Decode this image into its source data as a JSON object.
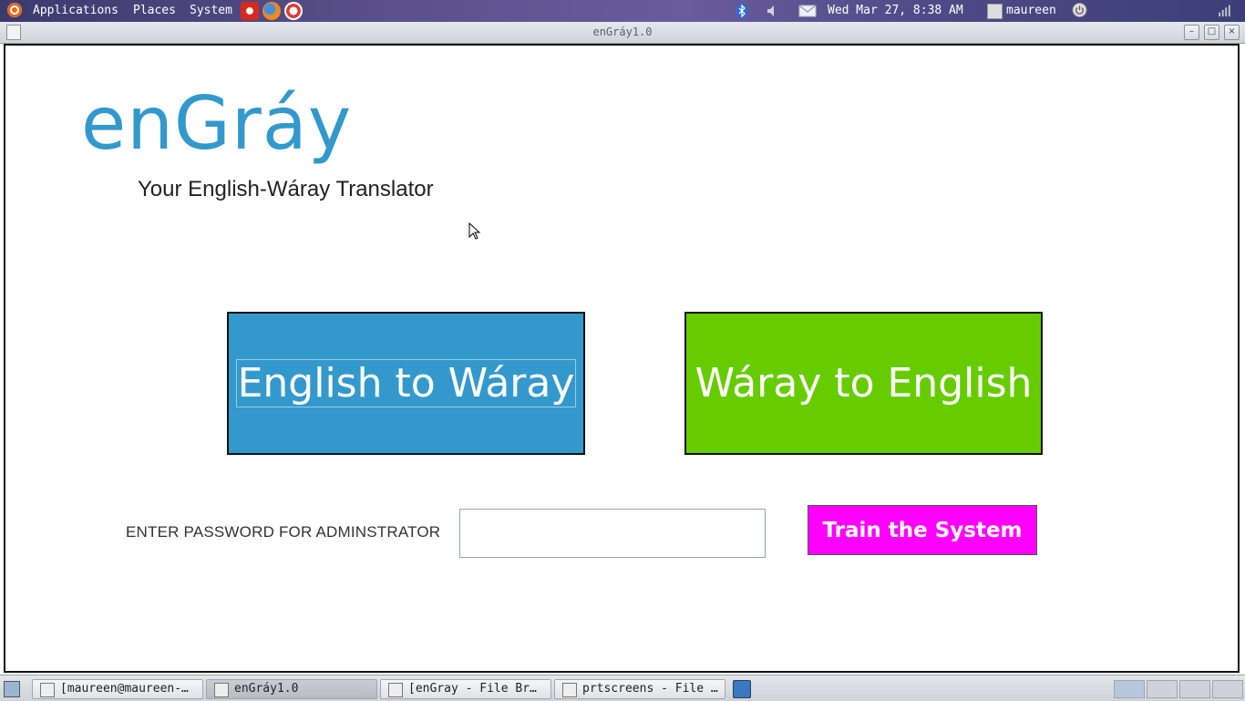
{
  "top_panel": {
    "menus": [
      "Applications",
      "Places",
      "System"
    ],
    "datetime": "Wed Mar 27,  8:38 AM",
    "user": "maureen"
  },
  "window": {
    "title": "enGráy1.0",
    "controls": [
      "minimize",
      "maximize",
      "close"
    ]
  },
  "app": {
    "logo": "enGráy",
    "tagline": "Your English-Wáray Translator",
    "english_to_waray": "English to Wáray",
    "waray_to_english": "Wáray to English",
    "password_label": "ENTER PASSWORD FOR ADMINSTRATOR",
    "password_value": "",
    "train_button": "Train the System",
    "colors": {
      "logo": "#3399cc",
      "english_to_waray_bg": "#3399cc",
      "waray_to_english_bg": "#66cc00",
      "train_bg": "#ff00ff"
    }
  },
  "taskbar": {
    "tasks": [
      {
        "label": "[maureen@maureen-…",
        "icon": "terminal-icon"
      },
      {
        "label": "enGráy1.0",
        "icon": "java-icon",
        "active": true
      },
      {
        "label": "[enGray - File Br…",
        "icon": "folder-icon"
      },
      {
        "label": "prtscreens - File …",
        "icon": "folder-icon"
      }
    ]
  }
}
